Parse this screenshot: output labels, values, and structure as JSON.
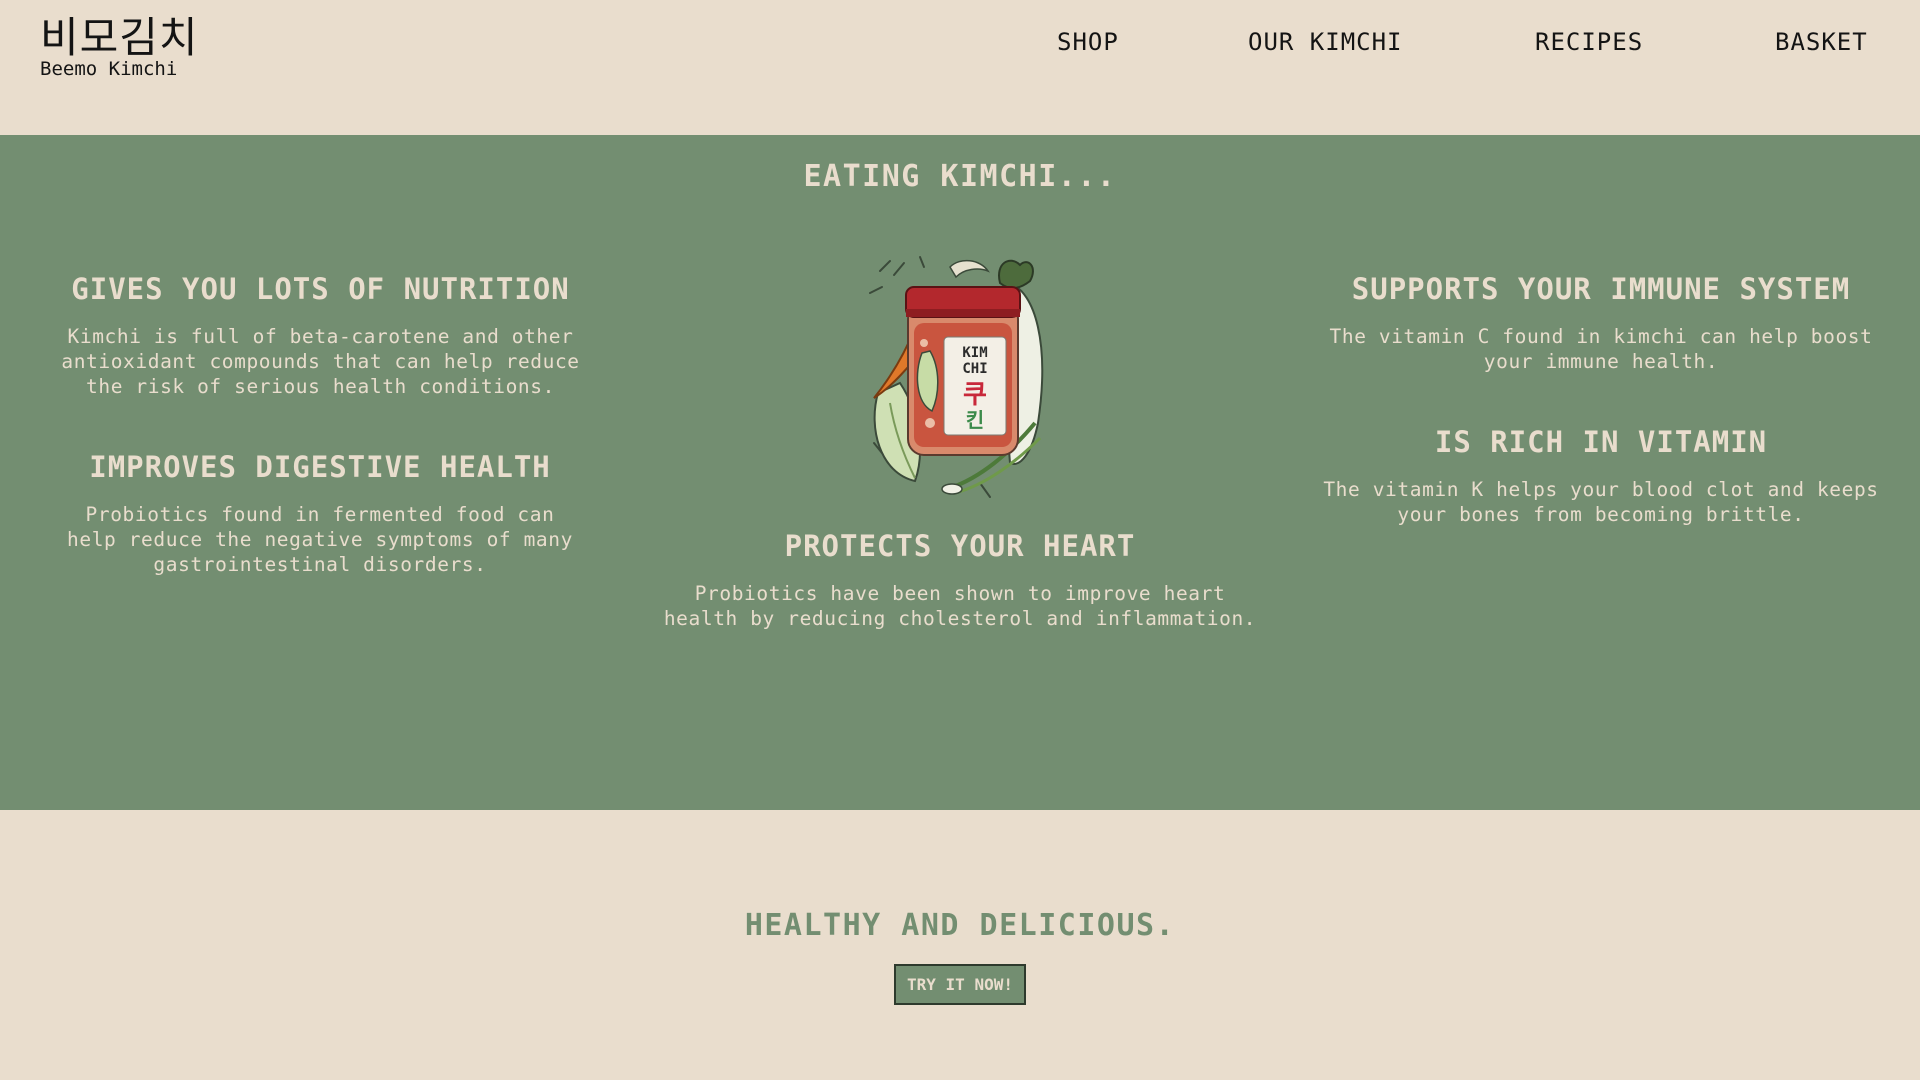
{
  "brand": {
    "korean_name": "비모김치",
    "english_name": "Beemo Kimchi"
  },
  "nav": {
    "items": [
      {
        "label": "SHOP"
      },
      {
        "label": "OUR KIMCHI"
      },
      {
        "label": "RECIPES"
      },
      {
        "label": "BASKET"
      }
    ]
  },
  "benefits": {
    "title": "EATING KIMCHI...",
    "items": [
      {
        "heading": "GIVES YOU LOTS OF NUTRITION",
        "text": "Kimchi is full of beta-carotene and other antioxidant compounds that can help reduce the risk of serious health conditions."
      },
      {
        "heading": "IMPROVES DIGESTIVE HEALTH",
        "text": "Probiotics found in fermented food can help reduce the negative symptoms of many gastrointestinal disorders."
      },
      {
        "heading": "PROTECTS YOUR HEART",
        "text": "Probiotics have been shown to improve heart health by reducing cholesterol and inflammation."
      },
      {
        "heading": "SUPPORTS YOUR IMMUNE SYSTEM",
        "text": "The vitamin C found in kimchi can help boost your immune health."
      },
      {
        "heading": "IS RICH IN VITAMIN",
        "text": "The vitamin K helps your blood clot and keeps your bones from becoming brittle."
      }
    ],
    "jar": {
      "label_line1": "KIM",
      "label_line2": "CHI",
      "label_korean": "쿠",
      "label_korean2": "킨"
    }
  },
  "cta": {
    "title": "HEALTHY AND DELICIOUS.",
    "button_label": "TRY IT NOW!"
  },
  "colors": {
    "cream": "#e9ddcd",
    "sage_green": "#738e71",
    "text_dark": "#141414",
    "jar_lid_red": "#b3282d"
  }
}
